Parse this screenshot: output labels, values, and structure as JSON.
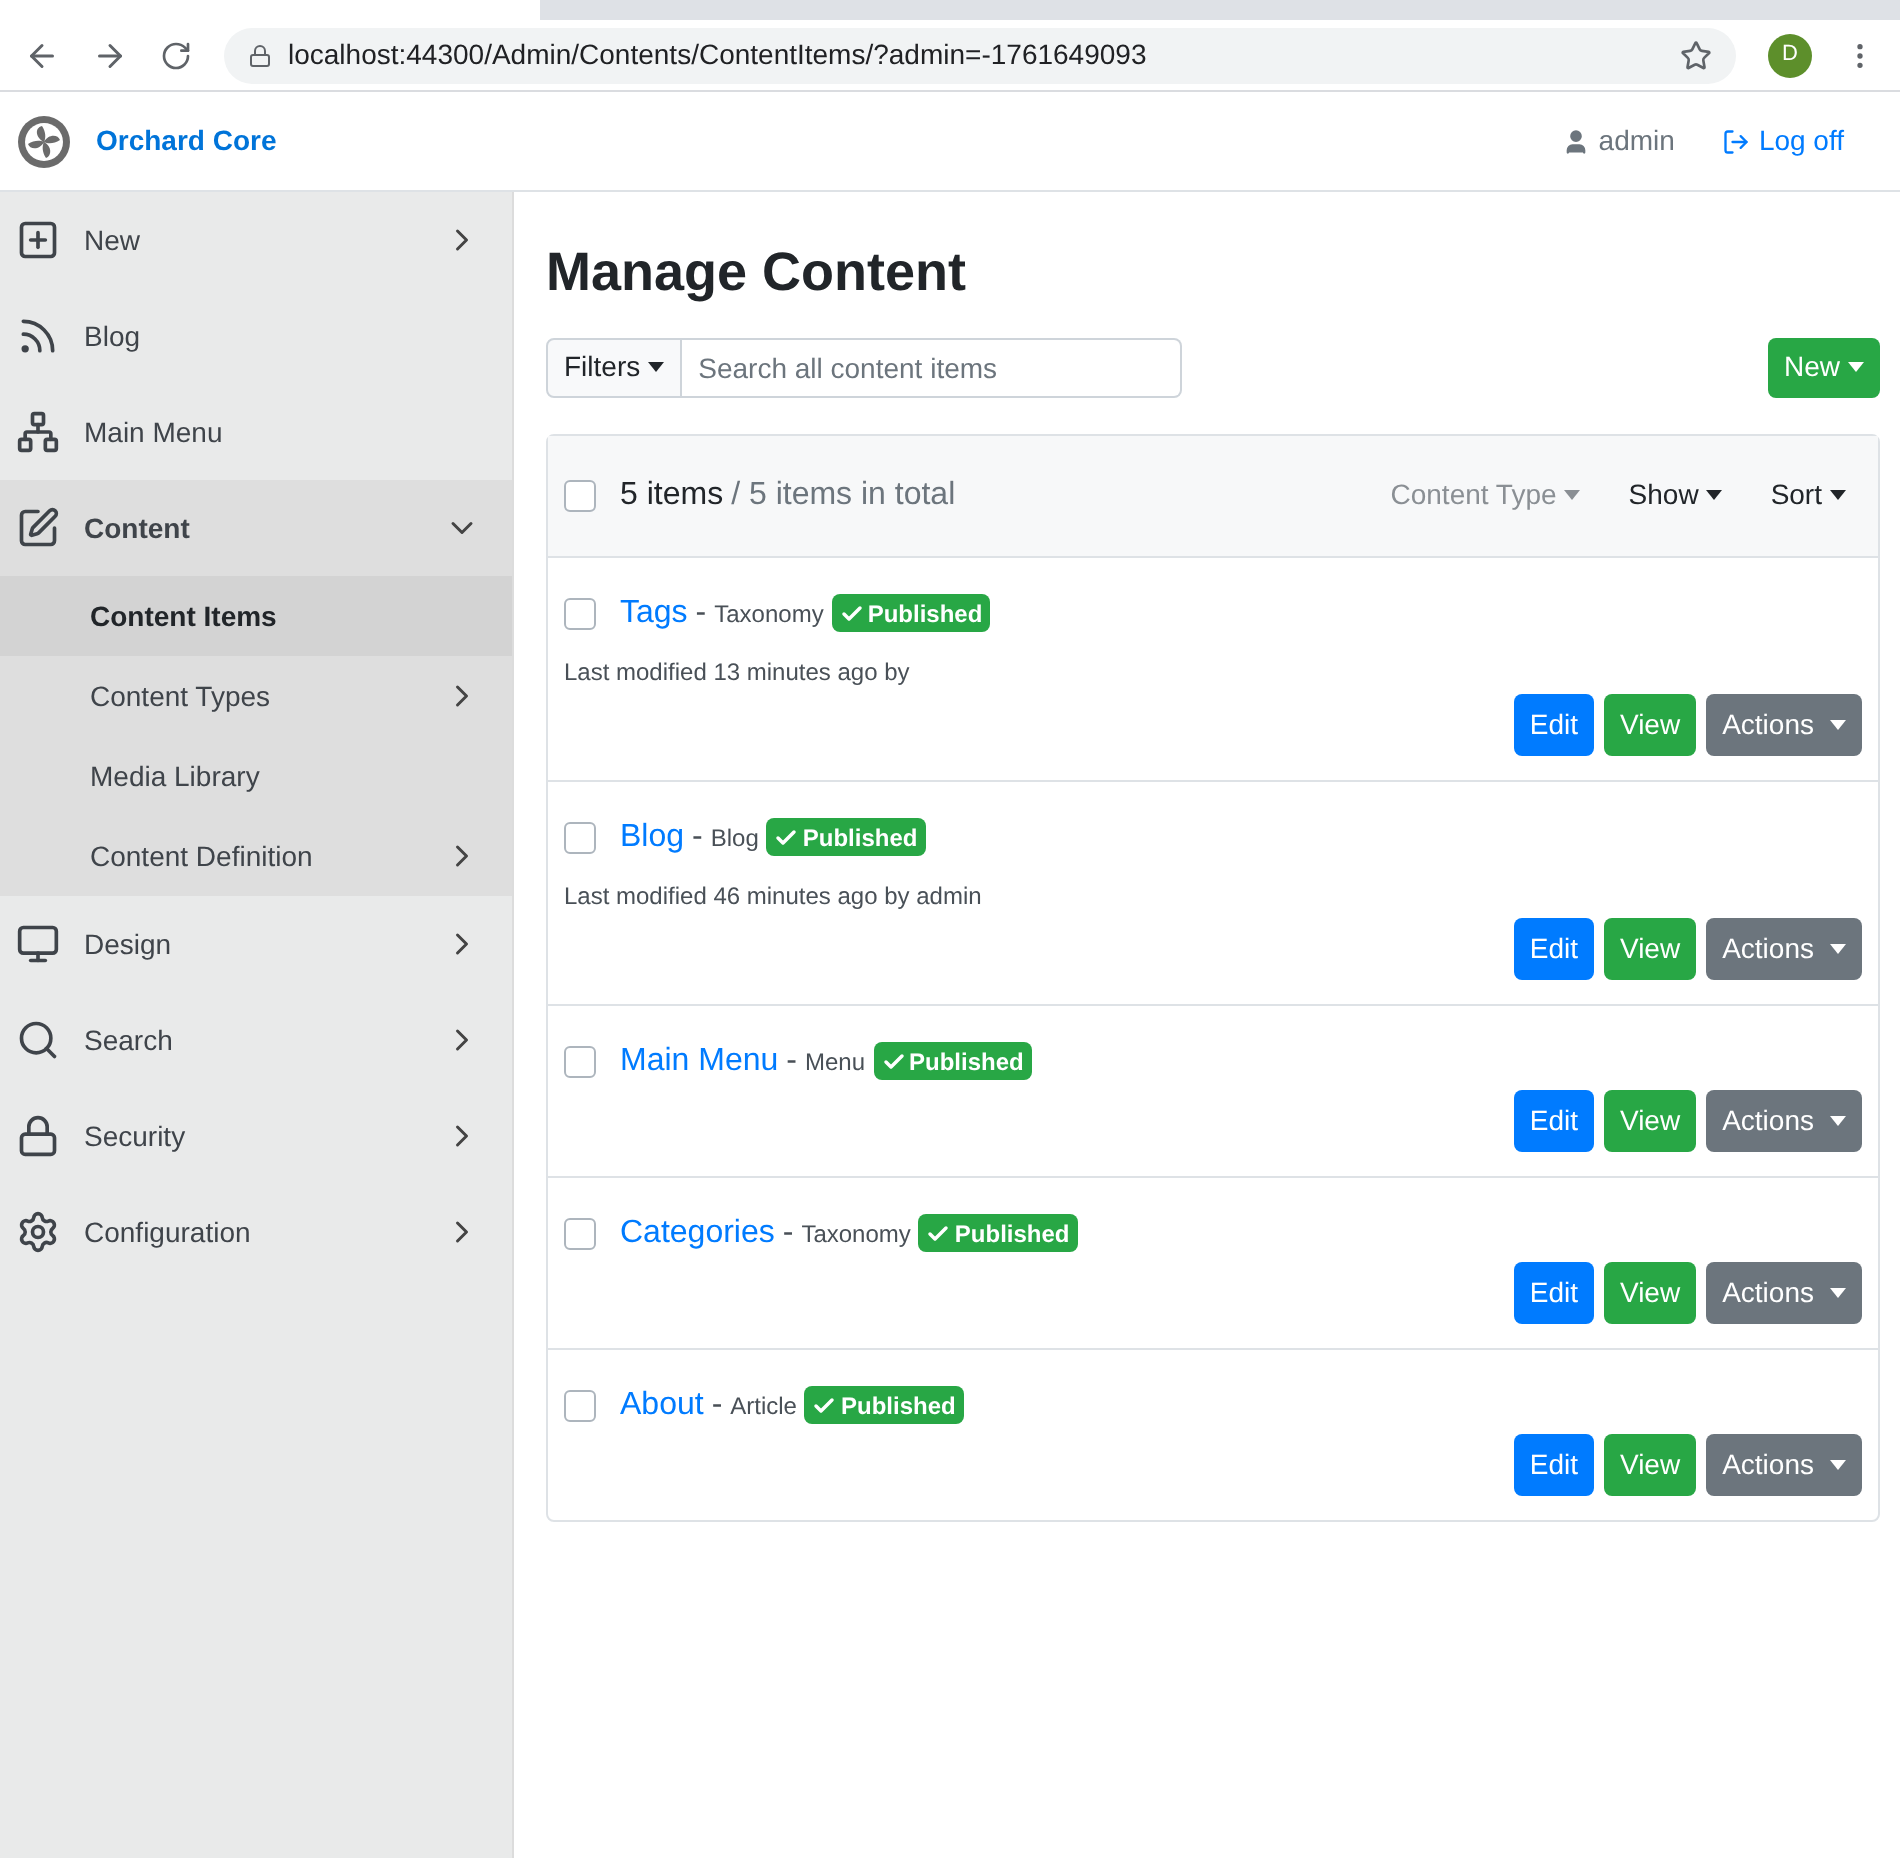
{
  "browser": {
    "url": "localhost:44300/Admin/Contents/ContentItems/?admin=-1761649093",
    "profile_initial": "D"
  },
  "header": {
    "brand": "Orchard Core",
    "user": "admin",
    "logoff": "Log off"
  },
  "sidebar": {
    "items": [
      {
        "label": "New",
        "kind": "group",
        "expanded": false
      },
      {
        "label": "Blog",
        "kind": "link"
      },
      {
        "label": "Main Menu",
        "kind": "link"
      },
      {
        "label": "Content",
        "kind": "group",
        "expanded": true,
        "children": [
          {
            "label": "Content Items",
            "kind": "link",
            "selected": true
          },
          {
            "label": "Content Types",
            "kind": "group",
            "expanded": false,
            "selected": false
          },
          {
            "label": "Media Library",
            "kind": "link",
            "selected": false
          },
          {
            "label": "Content Definition",
            "kind": "group",
            "expanded": false,
            "selected": false
          }
        ]
      },
      {
        "label": "Design",
        "kind": "group",
        "expanded": false
      },
      {
        "label": "Search",
        "kind": "group",
        "expanded": false
      },
      {
        "label": "Security",
        "kind": "group",
        "expanded": false
      },
      {
        "label": "Configuration",
        "kind": "group",
        "expanded": false
      }
    ]
  },
  "page": {
    "title": "Manage Content",
    "filters": "Filters",
    "search": {
      "placeholder": "Search all content items"
    },
    "new_button": "New"
  },
  "list": {
    "checked": false,
    "count": "5 items",
    "total": "/ 5 items in total",
    "content_type": "Content Type",
    "show": "Show",
    "sort": "Sort",
    "items": [
      {
        "title": "Tags",
        "separator": "-",
        "type": "Taxonomy",
        "status": "Published",
        "modified": "Last modified 13 minutes ago by",
        "checked": false,
        "buttons": {
          "edit": "Edit",
          "view": "View",
          "actions": "Actions"
        }
      },
      {
        "title": "Blog",
        "separator": "-",
        "type": "Blog",
        "status": "Published",
        "modified": "Last modified 46 minutes ago by admin",
        "checked": false,
        "buttons": {
          "edit": "Edit",
          "view": "View",
          "actions": "Actions"
        }
      },
      {
        "title": "Main Menu",
        "separator": "-",
        "type": "Menu",
        "status": "Published",
        "checked": false,
        "buttons": {
          "edit": "Edit",
          "view": "View",
          "actions": "Actions"
        }
      },
      {
        "title": "Categories",
        "separator": "-",
        "type": "Taxonomy",
        "status": "Published",
        "checked": false,
        "buttons": {
          "edit": "Edit",
          "view": "View",
          "actions": "Actions"
        }
      },
      {
        "title": "About",
        "separator": "-",
        "type": "Article",
        "status": "Published",
        "checked": false,
        "buttons": {
          "edit": "Edit",
          "view": "View",
          "actions": "Actions"
        }
      }
    ]
  }
}
